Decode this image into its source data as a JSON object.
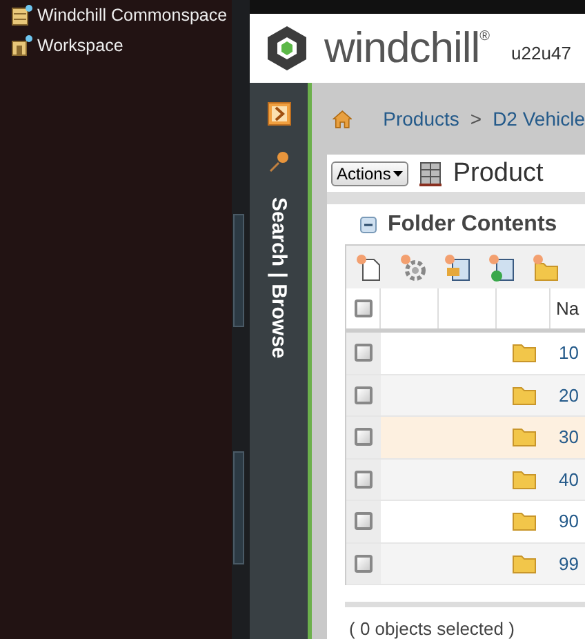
{
  "sidebar": {
    "items": [
      {
        "label": "Windchill Commonspace",
        "kind": "commonspace"
      },
      {
        "label": "Workspace",
        "kind": "workspace"
      }
    ]
  },
  "header": {
    "logo": "windchill$^{®}$",
    "user": "u22u47"
  },
  "nav": {
    "label": "Search | Browse"
  },
  "breadcrumb": {
    "items": [
      "Products",
      "D2 Vehicle"
    ],
    "separator": ">"
  },
  "page": {
    "actions_button": "Actions",
    "title": "Product"
  },
  "folder_contents": {
    "title": "Folder Contents",
    "header_checked": false,
    "name_column": "Na",
    "rows": [
      {
        "name": "10",
        "checked": false,
        "highlighted": false
      },
      {
        "name": "20",
        "checked": false,
        "highlighted": false
      },
      {
        "name": "30",
        "checked": false,
        "highlighted": true
      },
      {
        "name": "40",
        "checked": false,
        "highlighted": false
      },
      {
        "name": "90",
        "checked": false,
        "highlighted": false
      },
      {
        "name": "99",
        "checked": false,
        "highlighted": false
      }
    ],
    "status": "( 0 objects selected )"
  }
}
